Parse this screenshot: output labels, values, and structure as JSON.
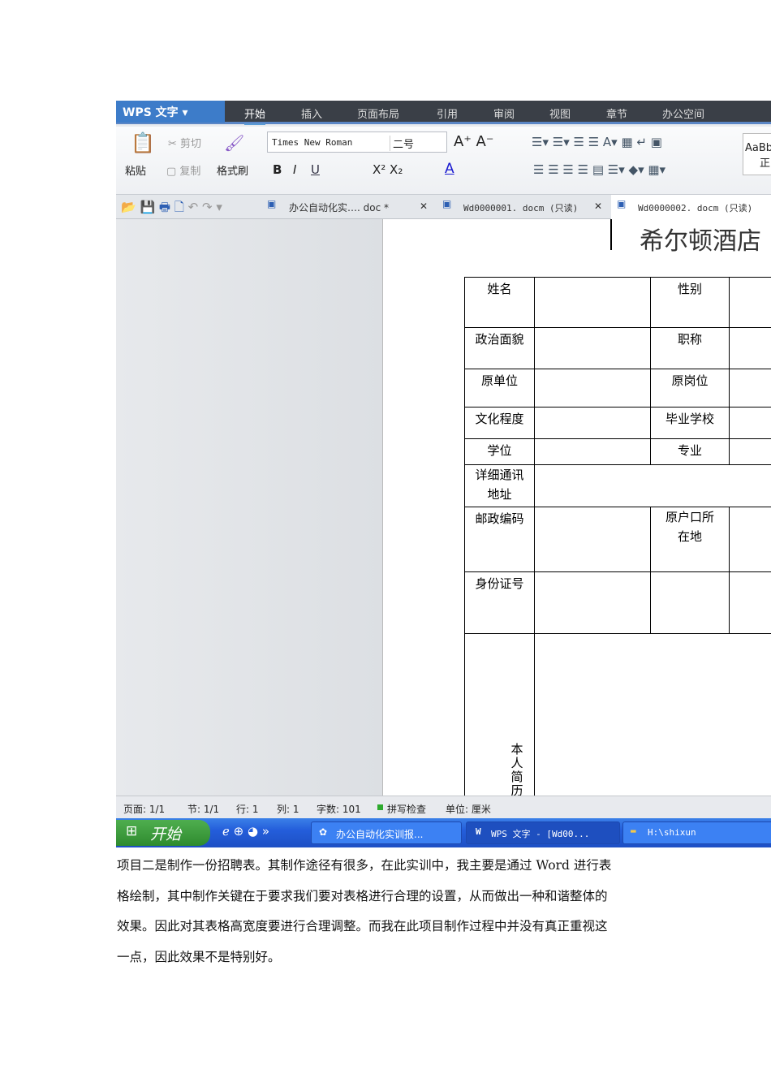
{
  "app": {
    "logo": "WPS 文字",
    "tabs": [
      "开始",
      "插入",
      "页面布局",
      "引用",
      "审阅",
      "视图",
      "章节",
      "办公空间"
    ]
  },
  "ribbon": {
    "paste": "粘贴",
    "cut": "剪切",
    "copy": "复制",
    "format_painter": "格式刷",
    "font": "Times New Roman",
    "size": "二号",
    "bold": "B",
    "italic": "I",
    "underline": "U",
    "style_preview": "AaBb",
    "style_name": "正"
  },
  "doc_tabs": [
    {
      "label": "办公自动化实…. doc *"
    },
    {
      "label": "Wd0000001. docm (只读)"
    },
    {
      "label": "Wd0000002. docm (只读)"
    }
  ],
  "document": {
    "title": "希尔顿酒店",
    "table": {
      "r1": [
        "姓名",
        "性别"
      ],
      "r2": [
        "政治面貌",
        "职称"
      ],
      "r3": [
        "原单位",
        "原岗位"
      ],
      "r4": [
        "文化程度",
        "毕业学校"
      ],
      "r5": [
        "学位",
        "专业"
      ],
      "r6": "详细通讯地址",
      "r7": [
        "邮政编码",
        "原户口所在地"
      ],
      "r8": "身份证号",
      "r9": "本人简历"
    }
  },
  "status": {
    "page": "页面: 1/1",
    "section": "节: 1/1",
    "line": "行: 1",
    "col": "列: 1",
    "words": "字数: 101",
    "spell": "拼写检查",
    "unit": "单位: 厘米"
  },
  "taskbar": {
    "start": "开始",
    "tasks": [
      "办公自动化实训报...",
      "WPS 文字 - [Wd00...",
      "H:\\shixun"
    ]
  },
  "paragraph": [
    "项目二是制作一份招聘表。其制作途径有很多，在此实训中，我主要是通过 Word 进行表",
    "格绘制，其中制作关键在于要求我们要对表格进行合理的设置，从而做出一种和谐整体的",
    "效果。因此对其表格高宽度要进行合理调整。而我在此项目制作过程中并没有真正重视这",
    "一点，因此效果不是特别好。"
  ]
}
